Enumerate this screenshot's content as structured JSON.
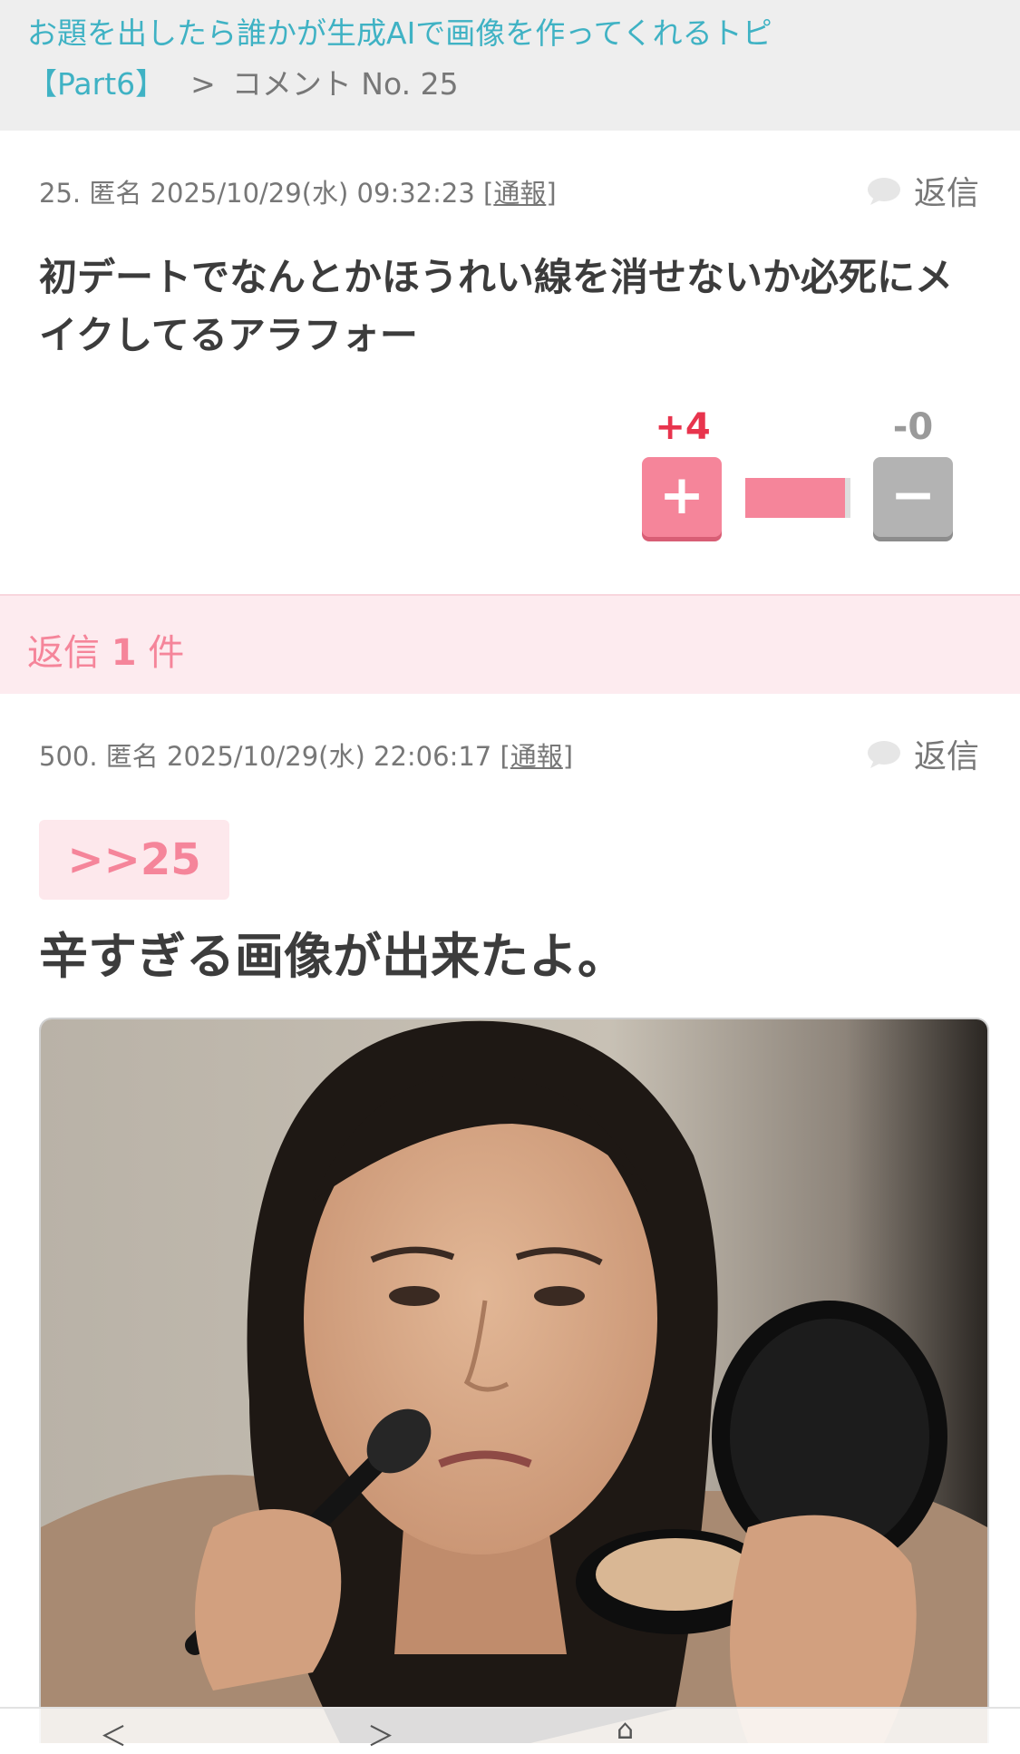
{
  "breadcrumb": {
    "topic_title": "お題を出したら誰かが生成AIで画像を作ってくれるトピ",
    "part": "【Part6】",
    "separator": ">",
    "current": "コメント No. 25"
  },
  "comment": {
    "meta_prefix": "25. 匿名 2025/10/29(水) 09:32:23 [",
    "report": "通報",
    "meta_suffix": "]",
    "reply_label": "返信",
    "body": "初デートでなんとかほうれい線を消せないか必死にメイクしてるアラフォー",
    "votes": {
      "plus_count": "+4",
      "minus_count": "-0",
      "plus_symbol": "+",
      "minus_symbol": "−",
      "plus_ratio": 0.95
    }
  },
  "replies": {
    "prefix": "返信",
    "count": "1",
    "suffix": "件"
  },
  "reply": {
    "meta_prefix": "500. 匿名 2025/10/29(水) 22:06:17 [",
    "report": "通報",
    "meta_suffix": "]",
    "reply_label": "返信",
    "anchor": ">>25",
    "headline": "辛すぎる画像が出来たよ。"
  },
  "nav": {
    "back": "＜",
    "forward": "＞",
    "share": "⌂"
  },
  "colors": {
    "accent_pink": "#f5859a",
    "link_teal": "#3fb2c4",
    "plus_red": "#e8344d"
  }
}
